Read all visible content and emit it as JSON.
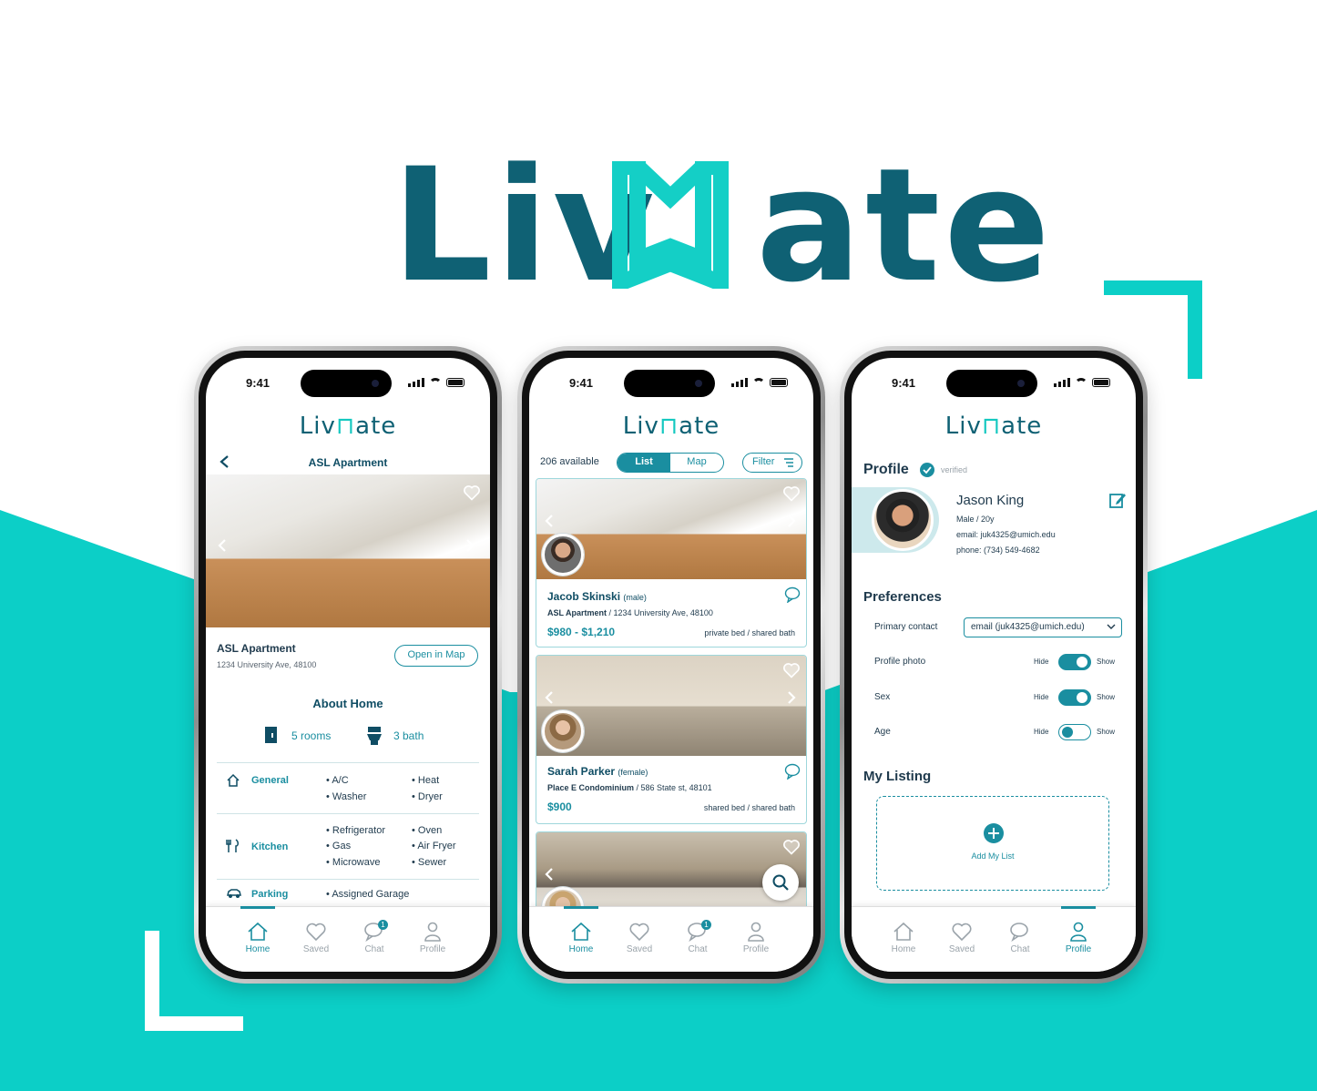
{
  "brand": {
    "name_left": "Liv",
    "name_right": "ate",
    "accent": "#0ccfc7",
    "primary": "#0f6174"
  },
  "status": {
    "time": "9:41"
  },
  "tabs": [
    {
      "label": "Home",
      "icon": "home-icon"
    },
    {
      "label": "Saved",
      "icon": "heart-icon"
    },
    {
      "label": "Chat",
      "icon": "chat-icon",
      "badge": "1"
    },
    {
      "label": "Profile",
      "icon": "person-icon"
    }
  ],
  "detail": {
    "title": "ASL Apartment",
    "name": "ASL Apartment",
    "address": "1234 University Ave, 48100",
    "map_button": "Open in Map",
    "about_title": "About Home",
    "rooms": "5 rooms",
    "bath": "3 bath",
    "sections": [
      {
        "label": "General",
        "col1": [
          "A/C",
          "Washer"
        ],
        "col2": [
          "Heat",
          "Dryer"
        ]
      },
      {
        "label": "Kitchen",
        "col1": [
          "Refrigerator",
          "Gas",
          "Microwave"
        ],
        "col2": [
          "Oven",
          "Air Fryer",
          "Sewer"
        ]
      },
      {
        "label": "Parking",
        "col1": [
          "Assigned Garage"
        ],
        "col2": []
      }
    ]
  },
  "list": {
    "available": "206 available",
    "seg_list": "List",
    "seg_map": "Map",
    "filter": "Filter",
    "cards": [
      {
        "name": "Jacob Skinski",
        "gender": "(male)",
        "place": "ASL Apartment",
        "address": "1234 University Ave, 48100",
        "price": "$980 - $1,210",
        "type": "private bed / shared bath"
      },
      {
        "name": "Sarah Parker",
        "gender": "(female)",
        "place": "Place E Condominium",
        "address": "586 State st, 48101",
        "price": "$900",
        "type": "shared bed / shared bath"
      }
    ]
  },
  "profile": {
    "title": "Profile",
    "verified": "verified",
    "name": "Jason King",
    "demo": "Male / 20y",
    "email": "email: juk4325@umich.edu",
    "phone": "phone: (734) 549-4682",
    "prefs_title": "Preferences",
    "primary_contact_label": "Primary contact",
    "primary_contact_value": "email (juk4325@umich.edu)",
    "hide": "Hide",
    "show": "Show",
    "toggles": [
      {
        "label": "Profile photo",
        "on": true
      },
      {
        "label": "Sex",
        "on": true
      },
      {
        "label": "Age",
        "on": false
      }
    ],
    "listing_title": "My Listing",
    "add_list": "Add My List"
  }
}
